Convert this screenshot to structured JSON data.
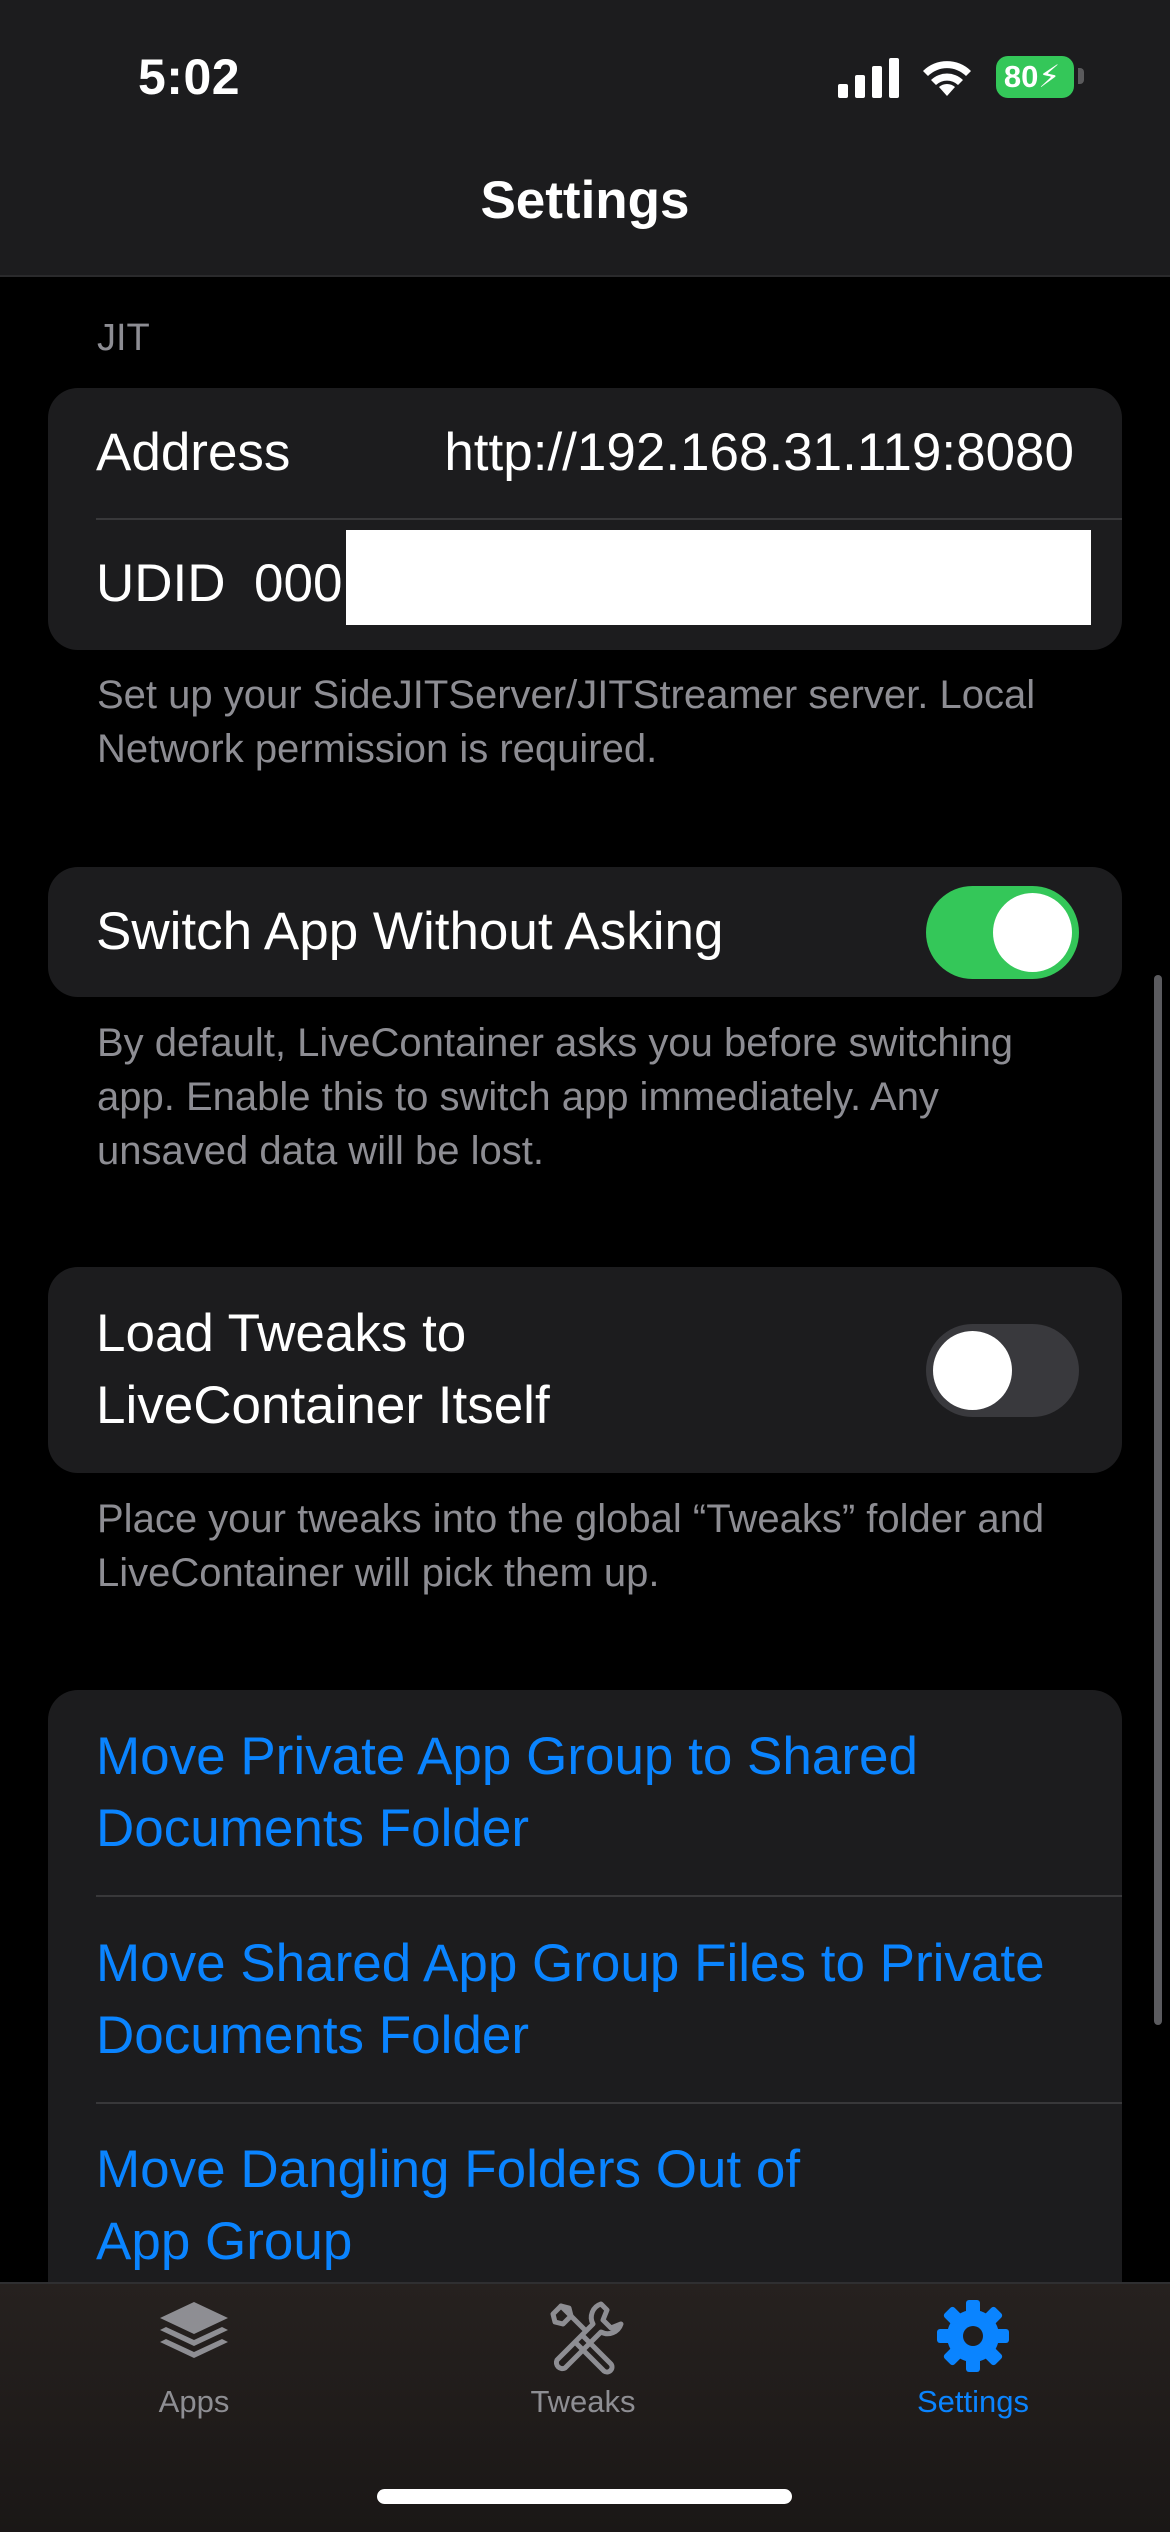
{
  "status_bar": {
    "time": "5:02",
    "battery_level": "80",
    "battery_color": "#34c759",
    "icons": [
      "signal-icon",
      "wifi-icon",
      "battery-charging-icon"
    ]
  },
  "nav": {
    "title": "Settings"
  },
  "jit_section": {
    "header": "JIT",
    "address_label": "Address",
    "address_value": "http://192.168.31.119:8080",
    "udid_label": "UDID",
    "udid_value": "000",
    "footer": "Set up your SideJITServer/JITStreamer server. Local Network permission is required."
  },
  "switch_app": {
    "label": "Switch App Without Asking",
    "enabled": true,
    "footer": "By default, LiveContainer asks you before switching app. Enable this to switch app immediately. Any unsaved data will be lost."
  },
  "load_tweaks": {
    "label": "Load Tweaks to LiveContainer Itself",
    "enabled": false,
    "footer": "Place your tweaks into the global “Tweaks” folder and LiveContainer will pick them up."
  },
  "actions": [
    {
      "label": "Move Private App Group to Shared Documents Folder"
    },
    {
      "label": "Move Shared App Group Files to Private Documents Folder"
    },
    {
      "label": "Move Dangling Folders Out of App Group"
    }
  ],
  "tabbar": {
    "tabs": [
      {
        "label": "Apps",
        "icon": "stack-icon",
        "active": false
      },
      {
        "label": "Tweaks",
        "icon": "wrench-screwdriver-icon",
        "active": false
      },
      {
        "label": "Settings",
        "icon": "gear-icon",
        "active": true
      }
    ]
  },
  "colors": {
    "accent": "#0a84ff",
    "toggle_on": "#34c759",
    "toggle_off": "#39393d",
    "cell_bg": "#1c1c1e",
    "secondary_text": "#8d8d93",
    "tab_inactive": "#8e8e93"
  }
}
